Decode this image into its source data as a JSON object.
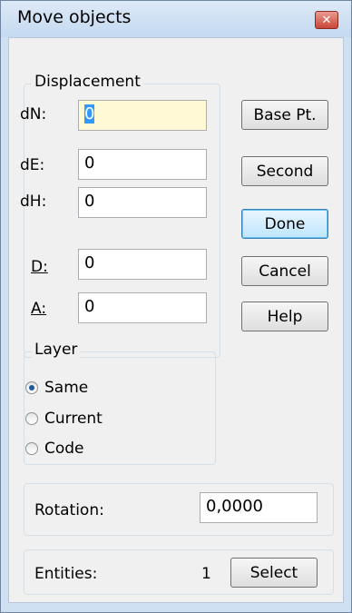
{
  "window": {
    "title": "Move objects",
    "close_glyph": "✕"
  },
  "displacement": {
    "title": "Displacement",
    "fields": [
      {
        "label": "dN:",
        "value": "0"
      },
      {
        "label": "dE:",
        "value": "0"
      },
      {
        "label": "dH:",
        "value": "0"
      },
      {
        "label": "D:",
        "value": "0"
      },
      {
        "label": "A:",
        "value": "0"
      }
    ]
  },
  "buttons": {
    "base_pt": "Base Pt.",
    "second": "Second",
    "done": "Done",
    "cancel": "Cancel",
    "help": "Help"
  },
  "layer": {
    "title": "Layer",
    "options": [
      {
        "label": "Same",
        "checked": true
      },
      {
        "label": "Current",
        "checked": false
      },
      {
        "label": "Code",
        "checked": false
      }
    ]
  },
  "rotation": {
    "label": "Rotation:",
    "value": "0,0000"
  },
  "entities": {
    "label": "Entities:",
    "count": "1",
    "select_label": "Select"
  },
  "colors": {
    "title_gradient_top": "#dde9f7",
    "close_red": "#c8473a",
    "focused_field": "#fff9d5",
    "selection": "#3399ff"
  },
  "icons": {
    "close": "close-icon"
  }
}
